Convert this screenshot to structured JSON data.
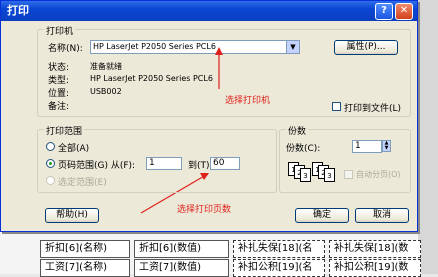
{
  "dialog": {
    "title": "打印",
    "help_glyph": "?",
    "close_glyph": "✕"
  },
  "printer": {
    "group_label": "打印机",
    "name_label": "名称(N):",
    "name_value": "HP LaserJet P2050 Series PCL6",
    "properties_button": "属性(P)...",
    "status_label": "状态:",
    "status_value": "准备就绪",
    "type_label": "类型:",
    "type_value": "HP LaserJet P2050 Series PCL6",
    "where_label": "位置:",
    "where_value": "USB002",
    "comment_label": "备注:",
    "print_to_file_label": "打印到文件(L)"
  },
  "range": {
    "group_label": "打印范围",
    "all_label": "全部(A)",
    "pages_label": "页码范围(G) 从(F):",
    "from_value": "1",
    "to_label": "到(T):",
    "to_value": "60",
    "selection_label": "选定范围(E)"
  },
  "copies": {
    "group_label": "份数",
    "count_label": "份数(C):",
    "count_value": "1",
    "collate_label": "自动分页(O)",
    "page_icons": [
      "1",
      "2",
      "3",
      "1",
      "2",
      "3"
    ]
  },
  "buttons": {
    "help": "帮助(H)",
    "ok": "确定",
    "cancel": "取消"
  },
  "annotations": {
    "select_printer": "选择打印机",
    "select_pages": "选择打印页数"
  },
  "background": {
    "row1": [
      "折扣[6](名称)",
      "折扣[6](数值)",
      "补扎失保[18](名",
      "补扎失保[18](数"
    ],
    "row2": [
      "工资[7](名称)",
      "工资[7](数值)",
      "补扣公积[19](名",
      "补扣公积[19](数"
    ]
  },
  "colors": {
    "annotation_red": "#e0201a",
    "titlebar_blue": "#0a46d4",
    "dialog_face": "#ece9d8"
  }
}
